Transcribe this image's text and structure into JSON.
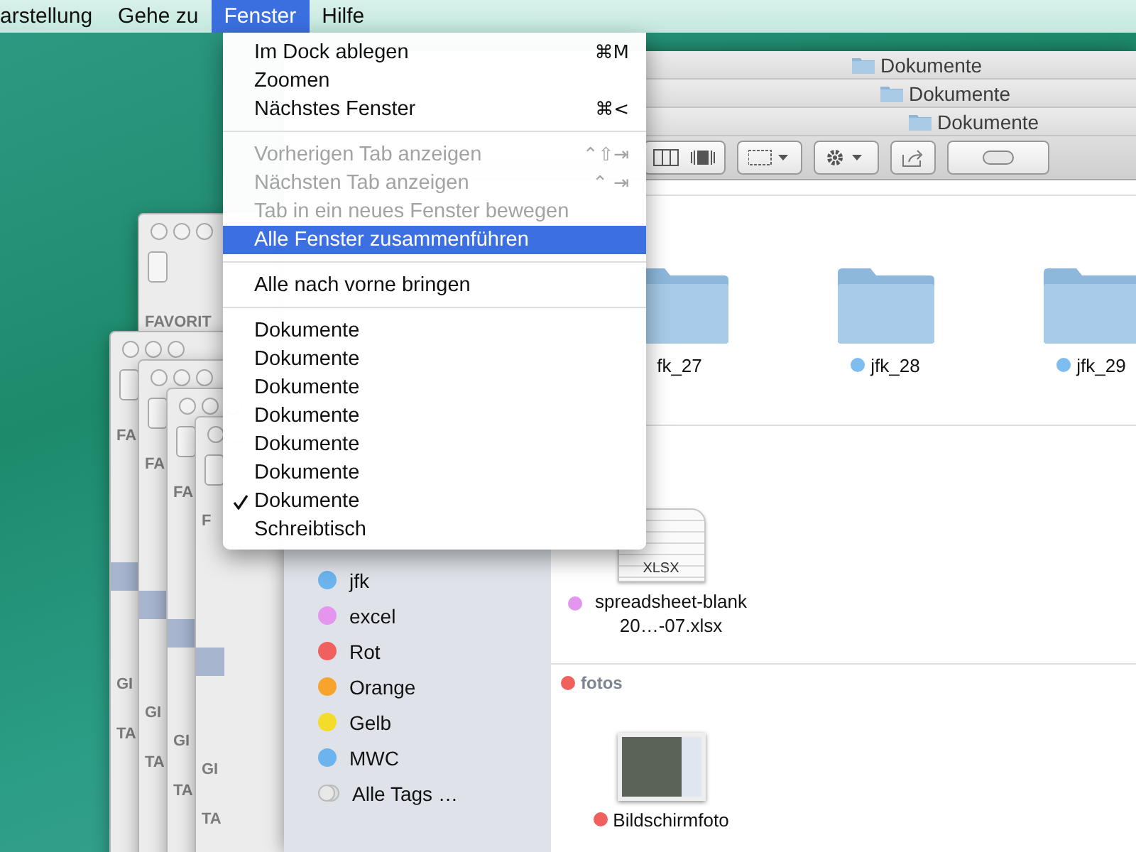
{
  "menu_bar": {
    "items": [
      {
        "label": "arstellung",
        "selected": false
      },
      {
        "label": "Gehe zu",
        "selected": false
      },
      {
        "label": "Fenster",
        "selected": true
      },
      {
        "label": "Hilfe",
        "selected": false
      }
    ]
  },
  "window_menu": {
    "items": [
      {
        "kind": "item",
        "label": "Im Dock ablegen",
        "shortcut": "⌘M",
        "disabled": false,
        "highlighted": false,
        "checked": false
      },
      {
        "kind": "item",
        "label": "Zoomen",
        "disabled": false,
        "highlighted": false,
        "checked": false
      },
      {
        "kind": "item",
        "label": "Nächstes Fenster",
        "shortcut": "⌘<",
        "disabled": false,
        "highlighted": false,
        "checked": false
      },
      {
        "kind": "separator"
      },
      {
        "kind": "item",
        "label": "Vorherigen Tab anzeigen",
        "shortcut": "⌃⇧⇥",
        "disabled": true,
        "highlighted": false,
        "checked": false
      },
      {
        "kind": "item",
        "label": "Nächsten Tab anzeigen",
        "shortcut": "⌃ ⇥",
        "disabled": true,
        "highlighted": false,
        "checked": false
      },
      {
        "kind": "item",
        "label": "Tab in ein neues Fenster bewegen",
        "disabled": true,
        "highlighted": false,
        "checked": false
      },
      {
        "kind": "item",
        "label": "Alle Fenster zusammenführen",
        "disabled": false,
        "highlighted": true,
        "checked": false
      },
      {
        "kind": "separator"
      },
      {
        "kind": "item",
        "label": "Alle nach vorne bringen",
        "disabled": false,
        "highlighted": false,
        "checked": false
      },
      {
        "kind": "separator"
      },
      {
        "kind": "item",
        "label": "Dokumente",
        "disabled": false,
        "highlighted": false,
        "checked": false
      },
      {
        "kind": "item",
        "label": "Dokumente",
        "disabled": false,
        "highlighted": false,
        "checked": false
      },
      {
        "kind": "item",
        "label": "Dokumente",
        "disabled": false,
        "highlighted": false,
        "checked": false
      },
      {
        "kind": "item",
        "label": "Dokumente",
        "disabled": false,
        "highlighted": false,
        "checked": false
      },
      {
        "kind": "item",
        "label": "Dokumente",
        "disabled": false,
        "highlighted": false,
        "checked": false
      },
      {
        "kind": "item",
        "label": "Dokumente",
        "disabled": false,
        "highlighted": false,
        "checked": false
      },
      {
        "kind": "item",
        "label": "Dokumente",
        "disabled": false,
        "highlighted": false,
        "checked": true
      },
      {
        "kind": "item",
        "label": "Schreibtisch",
        "disabled": false,
        "highlighted": false,
        "checked": false
      }
    ]
  },
  "back_windows": [
    {
      "labels": [
        "FAVORIT"
      ]
    },
    {
      "labels": [
        "FA",
        "GI",
        "TA"
      ]
    },
    {
      "labels": [
        "FA",
        "GI",
        "TA"
      ]
    },
    {
      "labels": [
        "FA",
        "GI",
        "TA"
      ]
    },
    {
      "labels": [
        "F",
        "GI",
        "TA"
      ]
    }
  ],
  "finder": {
    "tabs": [
      {
        "title": "Dokumente"
      },
      {
        "title": "Dokumente"
      },
      {
        "title": "Dokumente"
      }
    ],
    "sidebar": {
      "tags": [
        {
          "kind": "tag",
          "name": "jfk",
          "color": "#6cb4ee"
        },
        {
          "kind": "tag",
          "name": "excel",
          "color": "#e495ee"
        },
        {
          "kind": "tag",
          "name": "Rot",
          "color": "#f0605e"
        },
        {
          "kind": "tag",
          "name": "Orange",
          "color": "#f6a42c"
        },
        {
          "kind": "tag",
          "name": "Gelb",
          "color": "#f3dc2a"
        },
        {
          "kind": "tag",
          "name": "MWC",
          "color": "#6cb4ee"
        },
        {
          "kind": "all",
          "name": "Alle Tags …"
        }
      ]
    },
    "groups": [
      {
        "items": [
          {
            "kind": "folder",
            "name": "fk_27"
          },
          {
            "kind": "folder",
            "name": "jfk_28",
            "color": "#7dbdf0"
          },
          {
            "kind": "folder",
            "name": "jfk_29",
            "color": "#7dbdf0"
          }
        ]
      },
      {
        "items": [
          {
            "kind": "spreadsheet",
            "name": "spreadsheet-blank 20…-07.xlsx",
            "file_type": "XLSX",
            "color": "#e495ee"
          }
        ]
      },
      {
        "header": "fotos",
        "color": "#f0605e",
        "items": [
          {
            "kind": "image",
            "name": "Bildschirmfoto",
            "color": "#f0605e"
          }
        ]
      }
    ]
  }
}
